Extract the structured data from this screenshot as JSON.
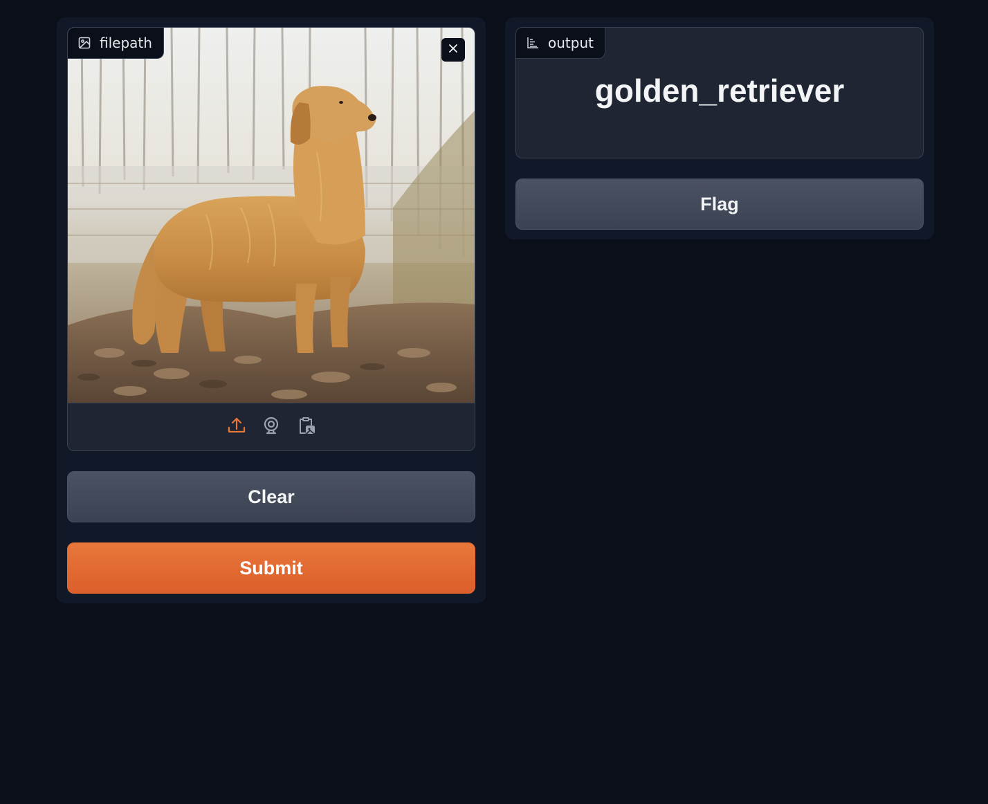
{
  "input": {
    "label": "filepath",
    "label_icon": "image-icon",
    "clear_icon": "close-icon",
    "sources": [
      {
        "icon": "upload-icon",
        "active": true
      },
      {
        "icon": "webcam-icon",
        "active": false
      },
      {
        "icon": "clipboard-icon",
        "active": false
      }
    ]
  },
  "output": {
    "label": "output",
    "label_icon": "bar-chart-icon",
    "value": "golden_retriever"
  },
  "buttons": {
    "clear": "Clear",
    "submit": "Submit",
    "flag": "Flag"
  },
  "colors": {
    "background": "#0b0f19",
    "panel": "#111827",
    "accent": "#e8773a",
    "secondary_button": "#4b5263"
  }
}
